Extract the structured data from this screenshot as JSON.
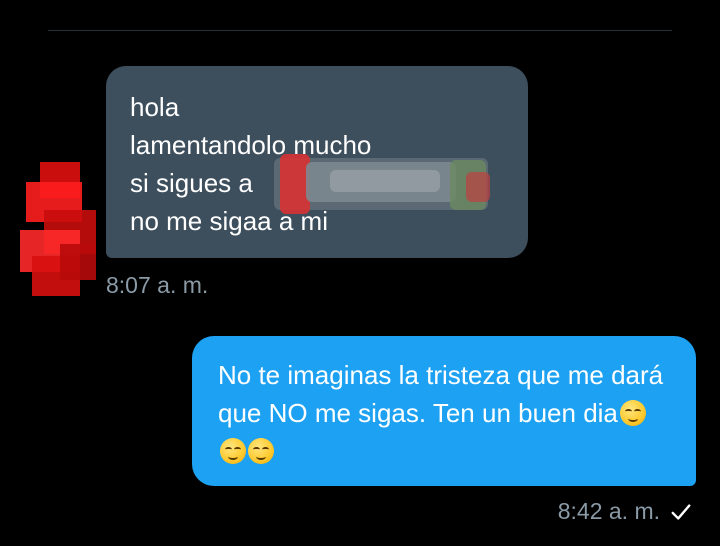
{
  "conversation": {
    "received": {
      "lines": [
        "hola",
        "lamentandolo mucho",
        "si sigues a",
        "no me sigaa a mi"
      ],
      "time": "8:07 a. m."
    },
    "sent": {
      "text": "No te imaginas la tristeza que me dará que NO me sigas. Ten un buen dia",
      "emojis": [
        "smirk-emoji",
        "wink-emoji",
        "smirk-emoji"
      ],
      "time": "8:42 a. m.",
      "status_icon": "check-icon"
    }
  },
  "colors": {
    "background": "#000000",
    "received_bubble": "#3d4e5c",
    "sent_bubble": "#1da1f2",
    "timestamp": "#8a9aa6",
    "censor_red": "#e01010"
  }
}
